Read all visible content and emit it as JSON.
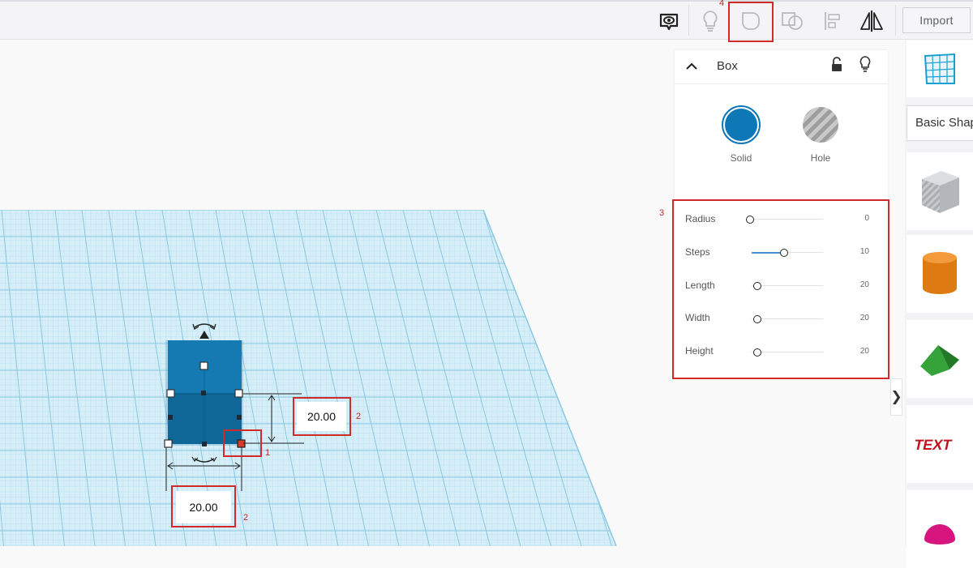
{
  "toolbar": {
    "import_label": "Import",
    "icons": [
      "comment-view-icon",
      "lightbulb-icon",
      "group-shape-icon",
      "ungroup-shape-icon",
      "align-icon",
      "mirror-icon"
    ]
  },
  "workplane": {
    "length_value": "20.00",
    "width_value": "20.00"
  },
  "annotations": {
    "a1": "1",
    "a2_right": "2",
    "a2_bottom": "2",
    "a3": "3",
    "a4": "4",
    "color": "#d02a2a"
  },
  "inspector": {
    "title": "Box",
    "solid_label": "Solid",
    "hole_label": "Hole",
    "solid_color": "#0e77b5",
    "params": [
      {
        "label": "Radius",
        "value": "0"
      },
      {
        "label": "Steps",
        "value": "10"
      },
      {
        "label": "Length",
        "value": "20"
      },
      {
        "label": "Width",
        "value": "20"
      },
      {
        "label": "Height",
        "value": "20"
      }
    ]
  },
  "shapes_panel": {
    "category": "Basic Shapes",
    "items": [
      "workplane-grid-icon",
      "box-hole-icon",
      "cylinder-icon",
      "roof-icon",
      "text-icon",
      "half-sphere-icon"
    ]
  },
  "collapse_glyph": "❯"
}
